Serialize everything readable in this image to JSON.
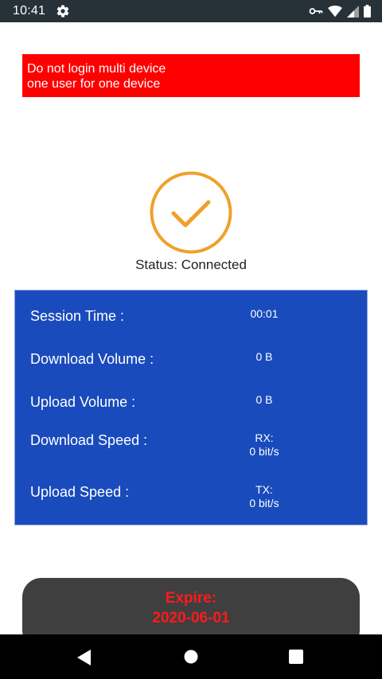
{
  "statusbar": {
    "time": "10:41"
  },
  "warning": {
    "line1": "Do not login multi device",
    "line2": "one user for one device"
  },
  "status": {
    "text": "Status: Connected",
    "ring_color": "#f0a02a"
  },
  "panel": {
    "background": "#1a4bbd",
    "rows": [
      {
        "label": "Session Time :",
        "value": "00:01"
      },
      {
        "label": "Download  Volume :",
        "value": "0 B"
      },
      {
        "label": "Upload Volume :",
        "value": "0 B"
      },
      {
        "label": "Download Speed :",
        "value_prefix": "RX:",
        "value": "0 bit/s"
      },
      {
        "label": "Upload Speed :",
        "value_prefix": "TX:",
        "value": "0 bit/s"
      }
    ]
  },
  "expire": {
    "label": "Expire:",
    "date": "2020-06-01"
  },
  "icons": {
    "statusbar": [
      "settings-gear-icon",
      "vpn-key-icon",
      "wifi-icon",
      "cell-signal-icon",
      "battery-icon"
    ],
    "navbar": [
      "back-icon",
      "home-icon",
      "recents-icon"
    ]
  }
}
